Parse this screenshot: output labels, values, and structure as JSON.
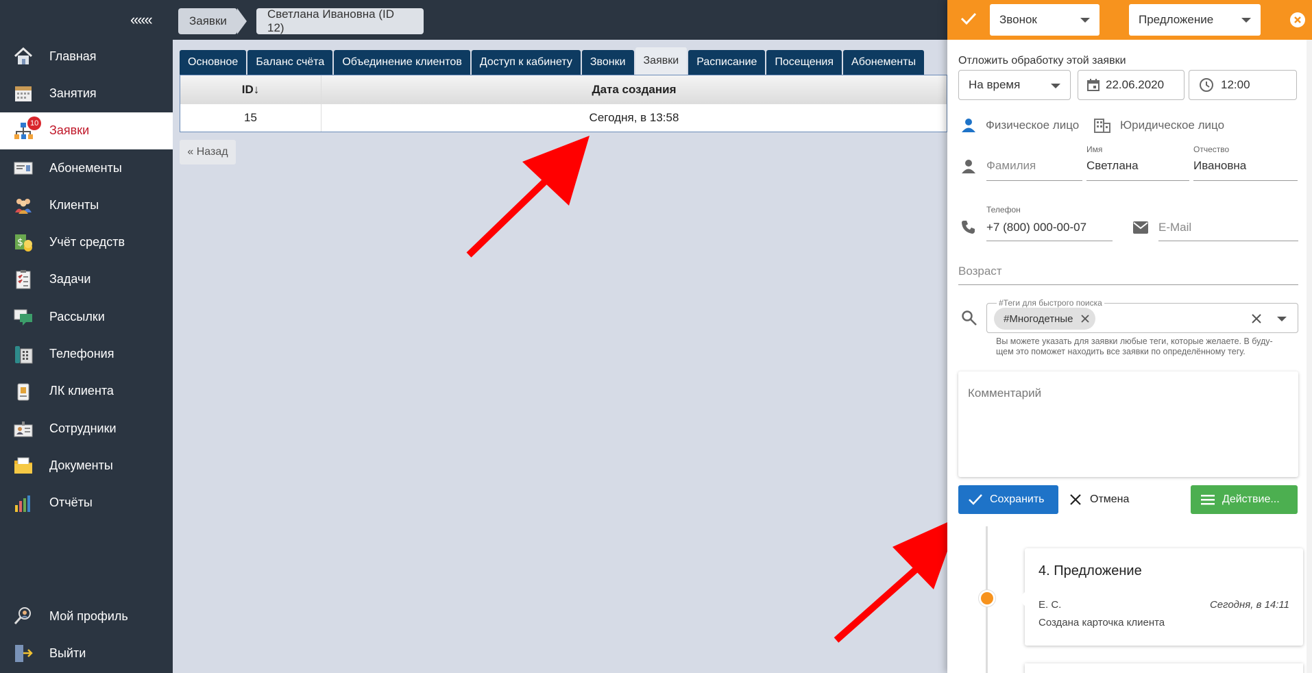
{
  "sidebar": {
    "collapse": "«««",
    "items": [
      {
        "label": "Главная",
        "icon": "home-icon"
      },
      {
        "label": "Занятия",
        "icon": "calendar-icon"
      },
      {
        "label": "Заявки",
        "icon": "requests-icon",
        "badge": "10",
        "active": true
      },
      {
        "label": "Абонементы",
        "icon": "subscription-card-icon"
      },
      {
        "label": "Клиенты",
        "icon": "clients-icon"
      },
      {
        "label": "Учёт средств",
        "icon": "money-icon"
      },
      {
        "label": "Задачи",
        "icon": "checklist-icon"
      },
      {
        "label": "Рассылки",
        "icon": "mailing-icon"
      },
      {
        "label": "Телефония",
        "icon": "phone-icon"
      },
      {
        "label": "ЛК клиента",
        "icon": "client-cabinet-icon"
      },
      {
        "label": "Сотрудники",
        "icon": "staff-icon"
      },
      {
        "label": "Документы",
        "icon": "documents-icon"
      },
      {
        "label": "Отчёты",
        "icon": "reports-icon"
      }
    ],
    "bottom": [
      {
        "label": "Мой профиль",
        "icon": "profile-icon"
      },
      {
        "label": "Выйти",
        "icon": "logout-icon"
      }
    ]
  },
  "breadcrumb": {
    "first": "Заявки",
    "second": "Светлана Ивановна (ID 12)"
  },
  "tabs": [
    "Основное",
    "Баланс счёта",
    "Объединение клиентов",
    "Доступ к кабинету",
    "Звонки",
    "Заявки",
    "Расписание",
    "Посещения",
    "Абонементы"
  ],
  "active_tab": "Заявки",
  "table": {
    "headers": [
      "ID↓",
      "Дата создания"
    ],
    "rows": [
      [
        "15",
        "Сегодня, в 13:58"
      ]
    ]
  },
  "back_button": "« Назад",
  "panel": {
    "source_select": "Звонок",
    "stage_select": "Предложение",
    "postpone_label": "Отложить обработку этой заявки",
    "postpone_mode": "На время",
    "date": "22.06.2020",
    "time": "12:00",
    "person_individual": "Физическое лицо",
    "person_legal": "Юридическое лицо",
    "surname_placeholder": "Фамилия",
    "name_label": "Имя",
    "name_value": "Светлана",
    "patronymic_label": "Отчество",
    "patronymic_value": "Ивановна",
    "phone_label": "Телефон",
    "phone_value": "+7 (800) 000-00-07",
    "email_placeholder": "E-Mail",
    "age_placeholder": "Возраст",
    "tags_label": "#Теги для быстрого поиска",
    "tag_chip": "#Многодетные",
    "tags_hint": "Вы можете указать для заявки любые теги, которые желаете. В буду-щем это поможет находить все заявки по определённому тегу.",
    "comment_placeholder": "Комментарий",
    "save": "Сохранить",
    "cancel": "Отмена",
    "action": "Действие..."
  },
  "timeline": {
    "card_title": "4. Предложение",
    "author": "Е. С.",
    "time": "Сегодня, в 14:11",
    "text": "Создана карточка клиента"
  },
  "colors": {
    "sidebar": "#2b3541",
    "accent_orange": "#f7931e",
    "tab_blue": "#0e3b61",
    "save_blue": "#1e73c8",
    "action_green": "#4caf50",
    "arrow_red": "#ff0000"
  }
}
